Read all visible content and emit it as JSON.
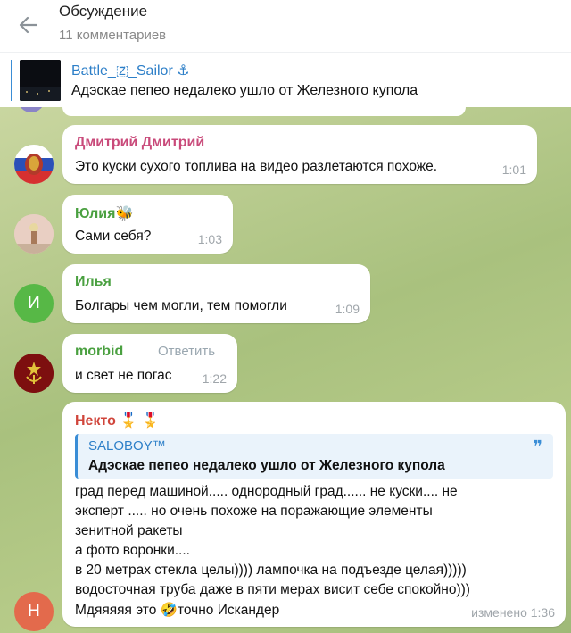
{
  "header": {
    "title": "Обсуждение",
    "subtitle": "11 комментариев"
  },
  "pinned": {
    "channel_name": "Battle_🇿_Sailor ⚓",
    "text": "Адэскае пепео недалеко ушло от Железного купола"
  },
  "messages": [
    {
      "author": "Дмитрий Дмитрий",
      "author_color": "#c94a7a",
      "text": "Это куски сухого топлива на видео разлетаются похоже.",
      "time": "1:01"
    },
    {
      "author": "Юлия🐝",
      "author_color": "#4aa040",
      "text": "Сами себя?",
      "time": "1:03"
    },
    {
      "author": "Илья",
      "author_color": "#4aa040",
      "avatar_letter": "И",
      "avatar_color": "#57b846",
      "text": "Болгары чем могли, тем помогли",
      "time": "1:09"
    },
    {
      "author": "morbid",
      "author_color": "#4aa040",
      "reply_label": "Ответить",
      "text": "и свет не погас",
      "time": "1:22"
    },
    {
      "author": "Некто 🎖️ 🎖️",
      "author_color": "#d0453b",
      "avatar_letter": "Н",
      "avatar_color": "#e36a4c",
      "quote": {
        "author": "SALOBOY™",
        "text": "Адэскае пепео недалеко ушло от Железного купола",
        "mark": "❞"
      },
      "lines": [
        "град перед машиной..... однородный град...... не куски.... не",
        "эксперт ..... но очень похоже на поражающие элементы",
        "зенитной ракеты",
        "а фото воронки....",
        "в 20 метрах стекла целы)))) лампочка на подъезде целая)))))",
        "водосточная труба даже в пяти мерах висит себе спокойно)))",
        "Мдяяяяя это 🤣точно Искандер"
      ],
      "time": "изменено 1:36"
    }
  ]
}
